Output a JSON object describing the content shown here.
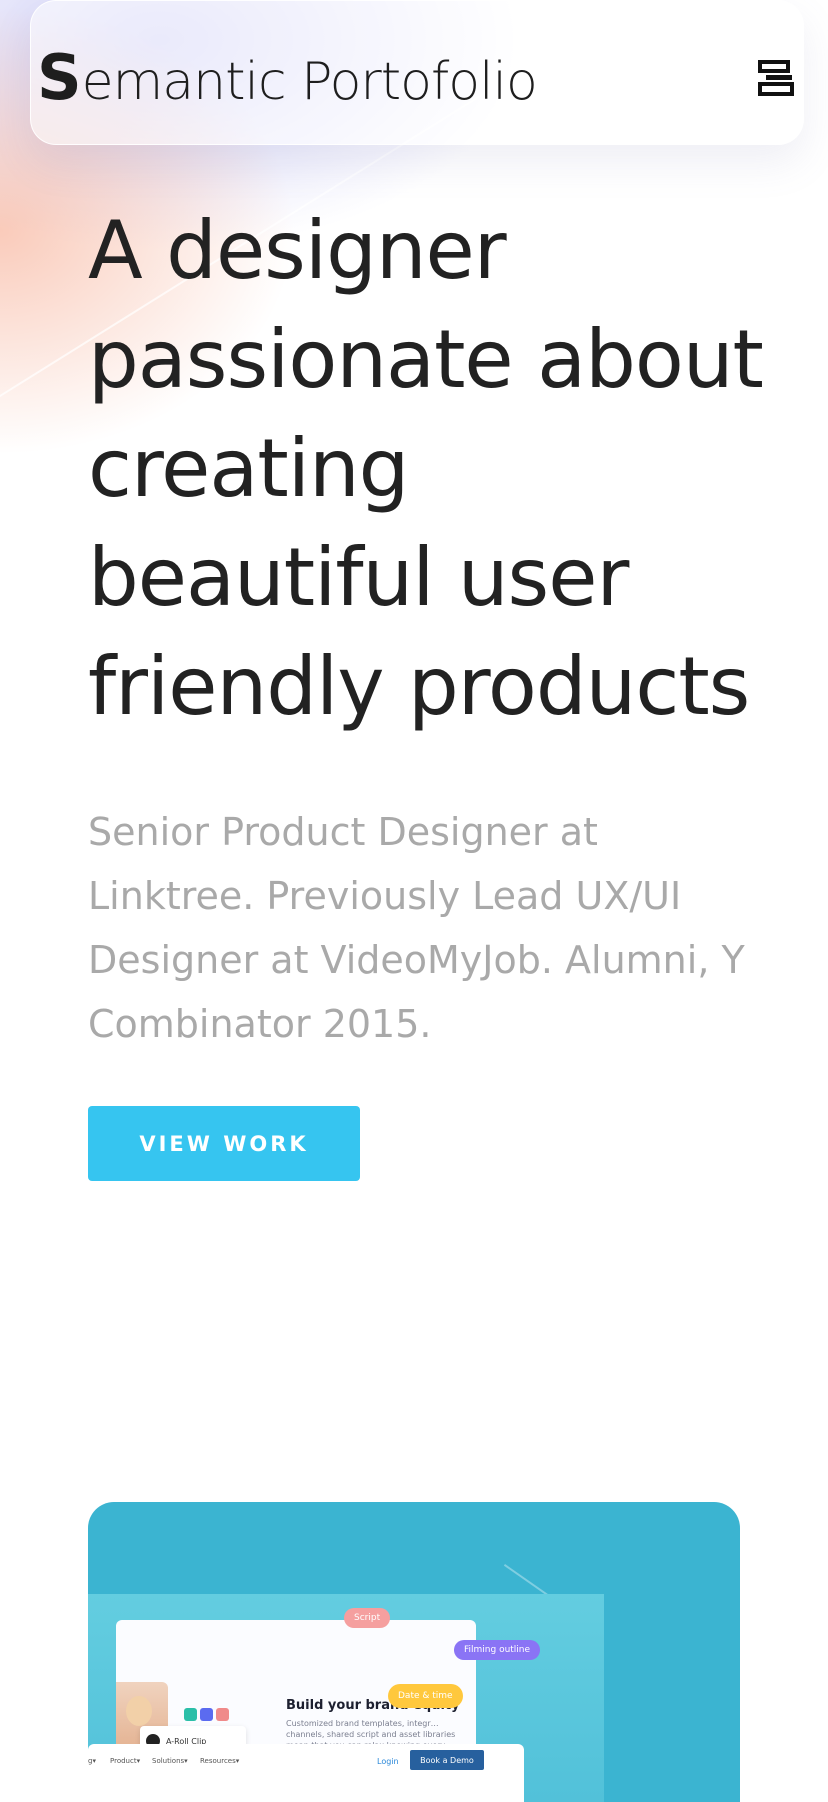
{
  "header": {
    "brand_initial": "S",
    "brand_rest": "emantic Portofolio",
    "menu_icon": "menu-bars-icon"
  },
  "hero": {
    "headline_lines": [
      "A designer",
      "passionate about",
      "creating",
      "beautiful user",
      "friendly products"
    ],
    "bio": "Senior Product Designer at Linktree. Previously Lead UX/UI Designer at VideoMyJob. Alumni, Y Combinator 2015.",
    "cta_label": "VIEW WORK"
  },
  "project_preview": {
    "heading": "Build your brand equity",
    "copy": "Customized brand templates, integr… channels, shared script and asset libraries mean that you can relax knowing every video is on-message and on-brand.",
    "pills": {
      "script": "Script",
      "filming": "Filming outline",
      "date": "Date & time"
    },
    "clip_label": "A-Roll Clip",
    "nav_items": [
      "g▾",
      "Product▾",
      "Solutions▾",
      "Resources▾"
    ],
    "login": "Login",
    "demo": "Book a Demo",
    "swatches": [
      "#2bbfa8",
      "#5b6bf0",
      "#f08a8a"
    ]
  },
  "colors": {
    "accent": "#36c5f0",
    "card_bg": "#3bb4d1",
    "headline": "#222222",
    "bio": "#a9a9a9"
  }
}
